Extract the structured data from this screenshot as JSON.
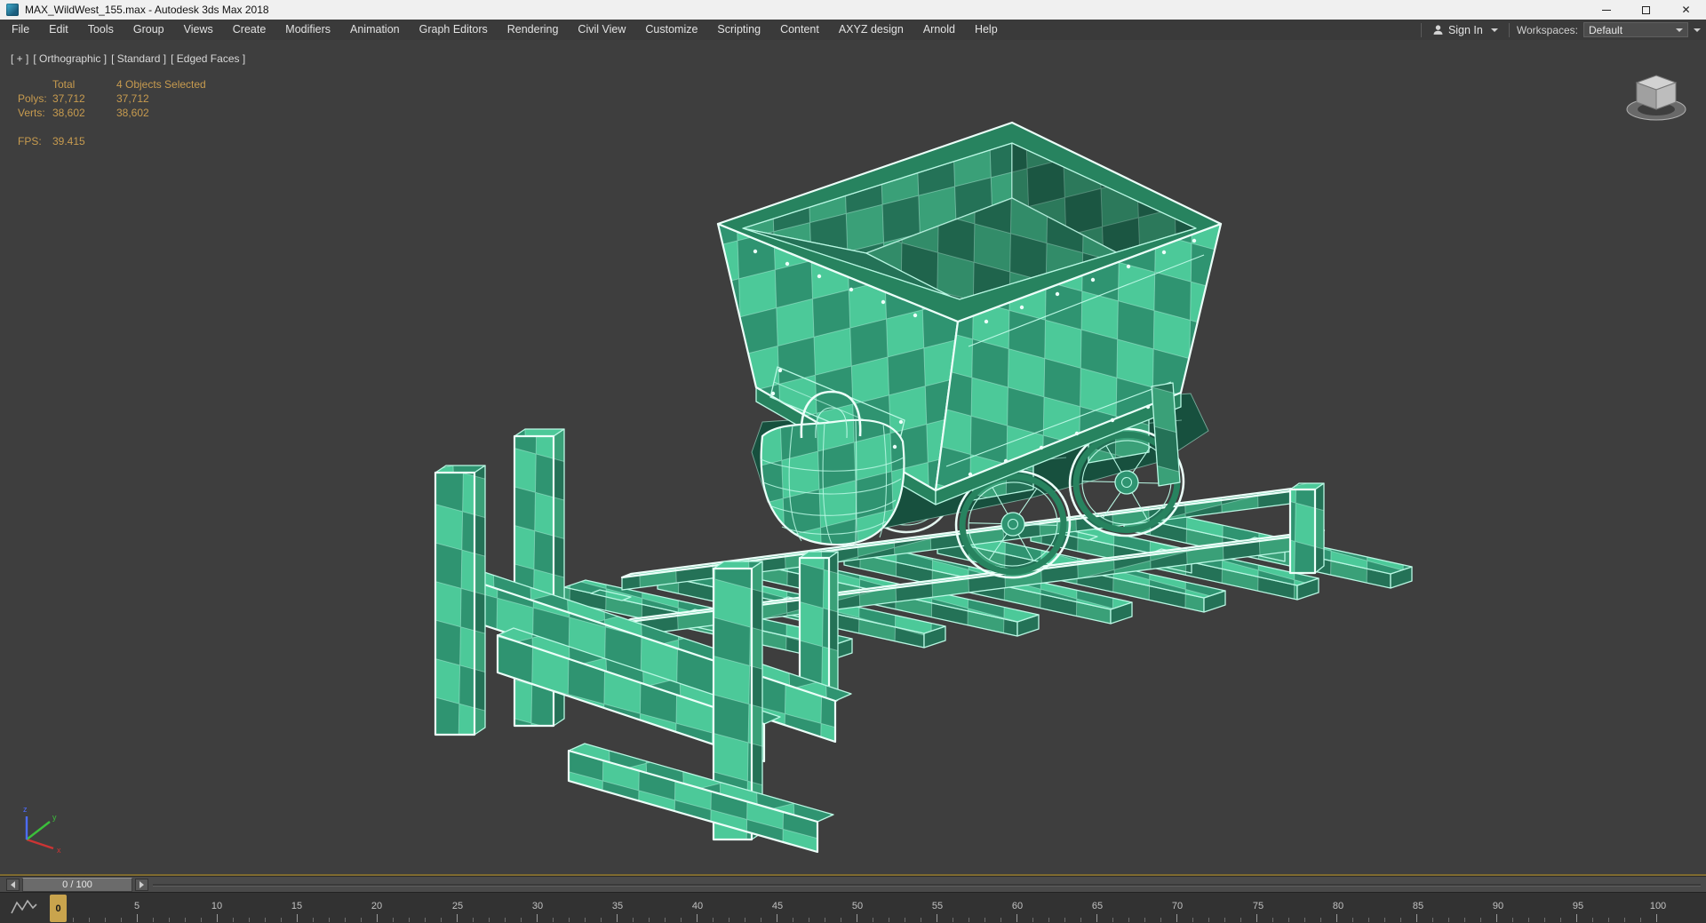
{
  "window": {
    "title": "MAX_WildWest_155.max - Autodesk 3ds Max 2018",
    "controls": {
      "close": "✕"
    }
  },
  "menu": {
    "items": [
      "File",
      "Edit",
      "Tools",
      "Group",
      "Views",
      "Create",
      "Modifiers",
      "Animation",
      "Graph Editors",
      "Rendering",
      "Civil View",
      "Customize",
      "Scripting",
      "Content",
      "AXYZ design",
      "Arnold",
      "Help"
    ],
    "sign_in": "Sign In",
    "workspaces_label": "Workspaces:",
    "workspace_value": "Default"
  },
  "viewport": {
    "label_parts": [
      "[ + ]",
      "[ Orthographic ]",
      "[ Standard ]",
      "[ Edged Faces ]"
    ],
    "stats": {
      "col1_header": "Total",
      "col2_header": "4 Objects Selected",
      "polys_label": "Polys:",
      "polys_total": "37,712",
      "polys_selected": "37,712",
      "verts_label": "Verts:",
      "verts_total": "38,602",
      "verts_selected": "38,602",
      "fps_label": "FPS:",
      "fps_value": "39.415"
    }
  },
  "timeline": {
    "time_display": "0 / 100",
    "current_frame": "0",
    "tick_labels": [
      "5",
      "10",
      "15",
      "20",
      "25",
      "30",
      "35",
      "40",
      "45",
      "50",
      "55",
      "60",
      "65",
      "70",
      "75",
      "80",
      "85",
      "90",
      "95",
      "100"
    ]
  },
  "colors": {
    "titlebar_bg": "#f0f0f0",
    "titlebar_text": "#111111",
    "menubar_bg": "#3a3a3a",
    "menubar_text": "#e2e2e2",
    "viewport_bg": "#3e3e3e",
    "checker_light": "#4cc999",
    "checker_dark": "#2f9471",
    "checker_light_shade": "#3aa078",
    "checker_dark_shade": "#247257",
    "edge": "#b9f7e3",
    "edge_bright": "#ecfff9",
    "dark_side": "#27835f",
    "underbody": "#17503e",
    "stats_text": "#c79b4f",
    "label_text": "#d8d8d8",
    "active_border": "#7f6b2f",
    "slider_bg": "#4a4a4a",
    "handle_bg": "#6b6b6b",
    "ruler_bg": "#323232",
    "ruler_text": "#c2c2c2",
    "frame_marker_bg": "#c9a44d"
  }
}
